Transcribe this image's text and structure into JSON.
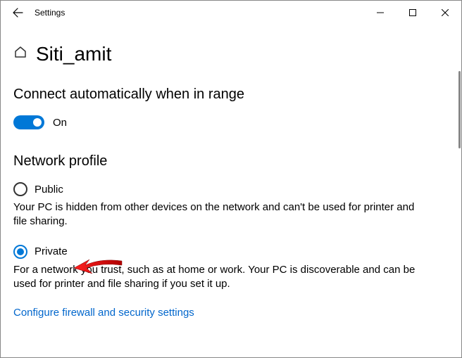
{
  "titlebar": {
    "app_name": "Settings"
  },
  "page": {
    "network_name": "Siti_amit"
  },
  "auto_connect": {
    "heading": "Connect automatically when in range",
    "state_label": "On"
  },
  "network_profile": {
    "heading": "Network profile",
    "public": {
      "label": "Public",
      "desc": "Your PC is hidden from other devices on the network and can't be used for printer and file sharing."
    },
    "private": {
      "label": "Private",
      "desc": "For a network you trust, such as at home or work. Your PC is discoverable and can be used for printer and file sharing if you set it up."
    }
  },
  "links": {
    "firewall": "Configure firewall and security settings"
  }
}
